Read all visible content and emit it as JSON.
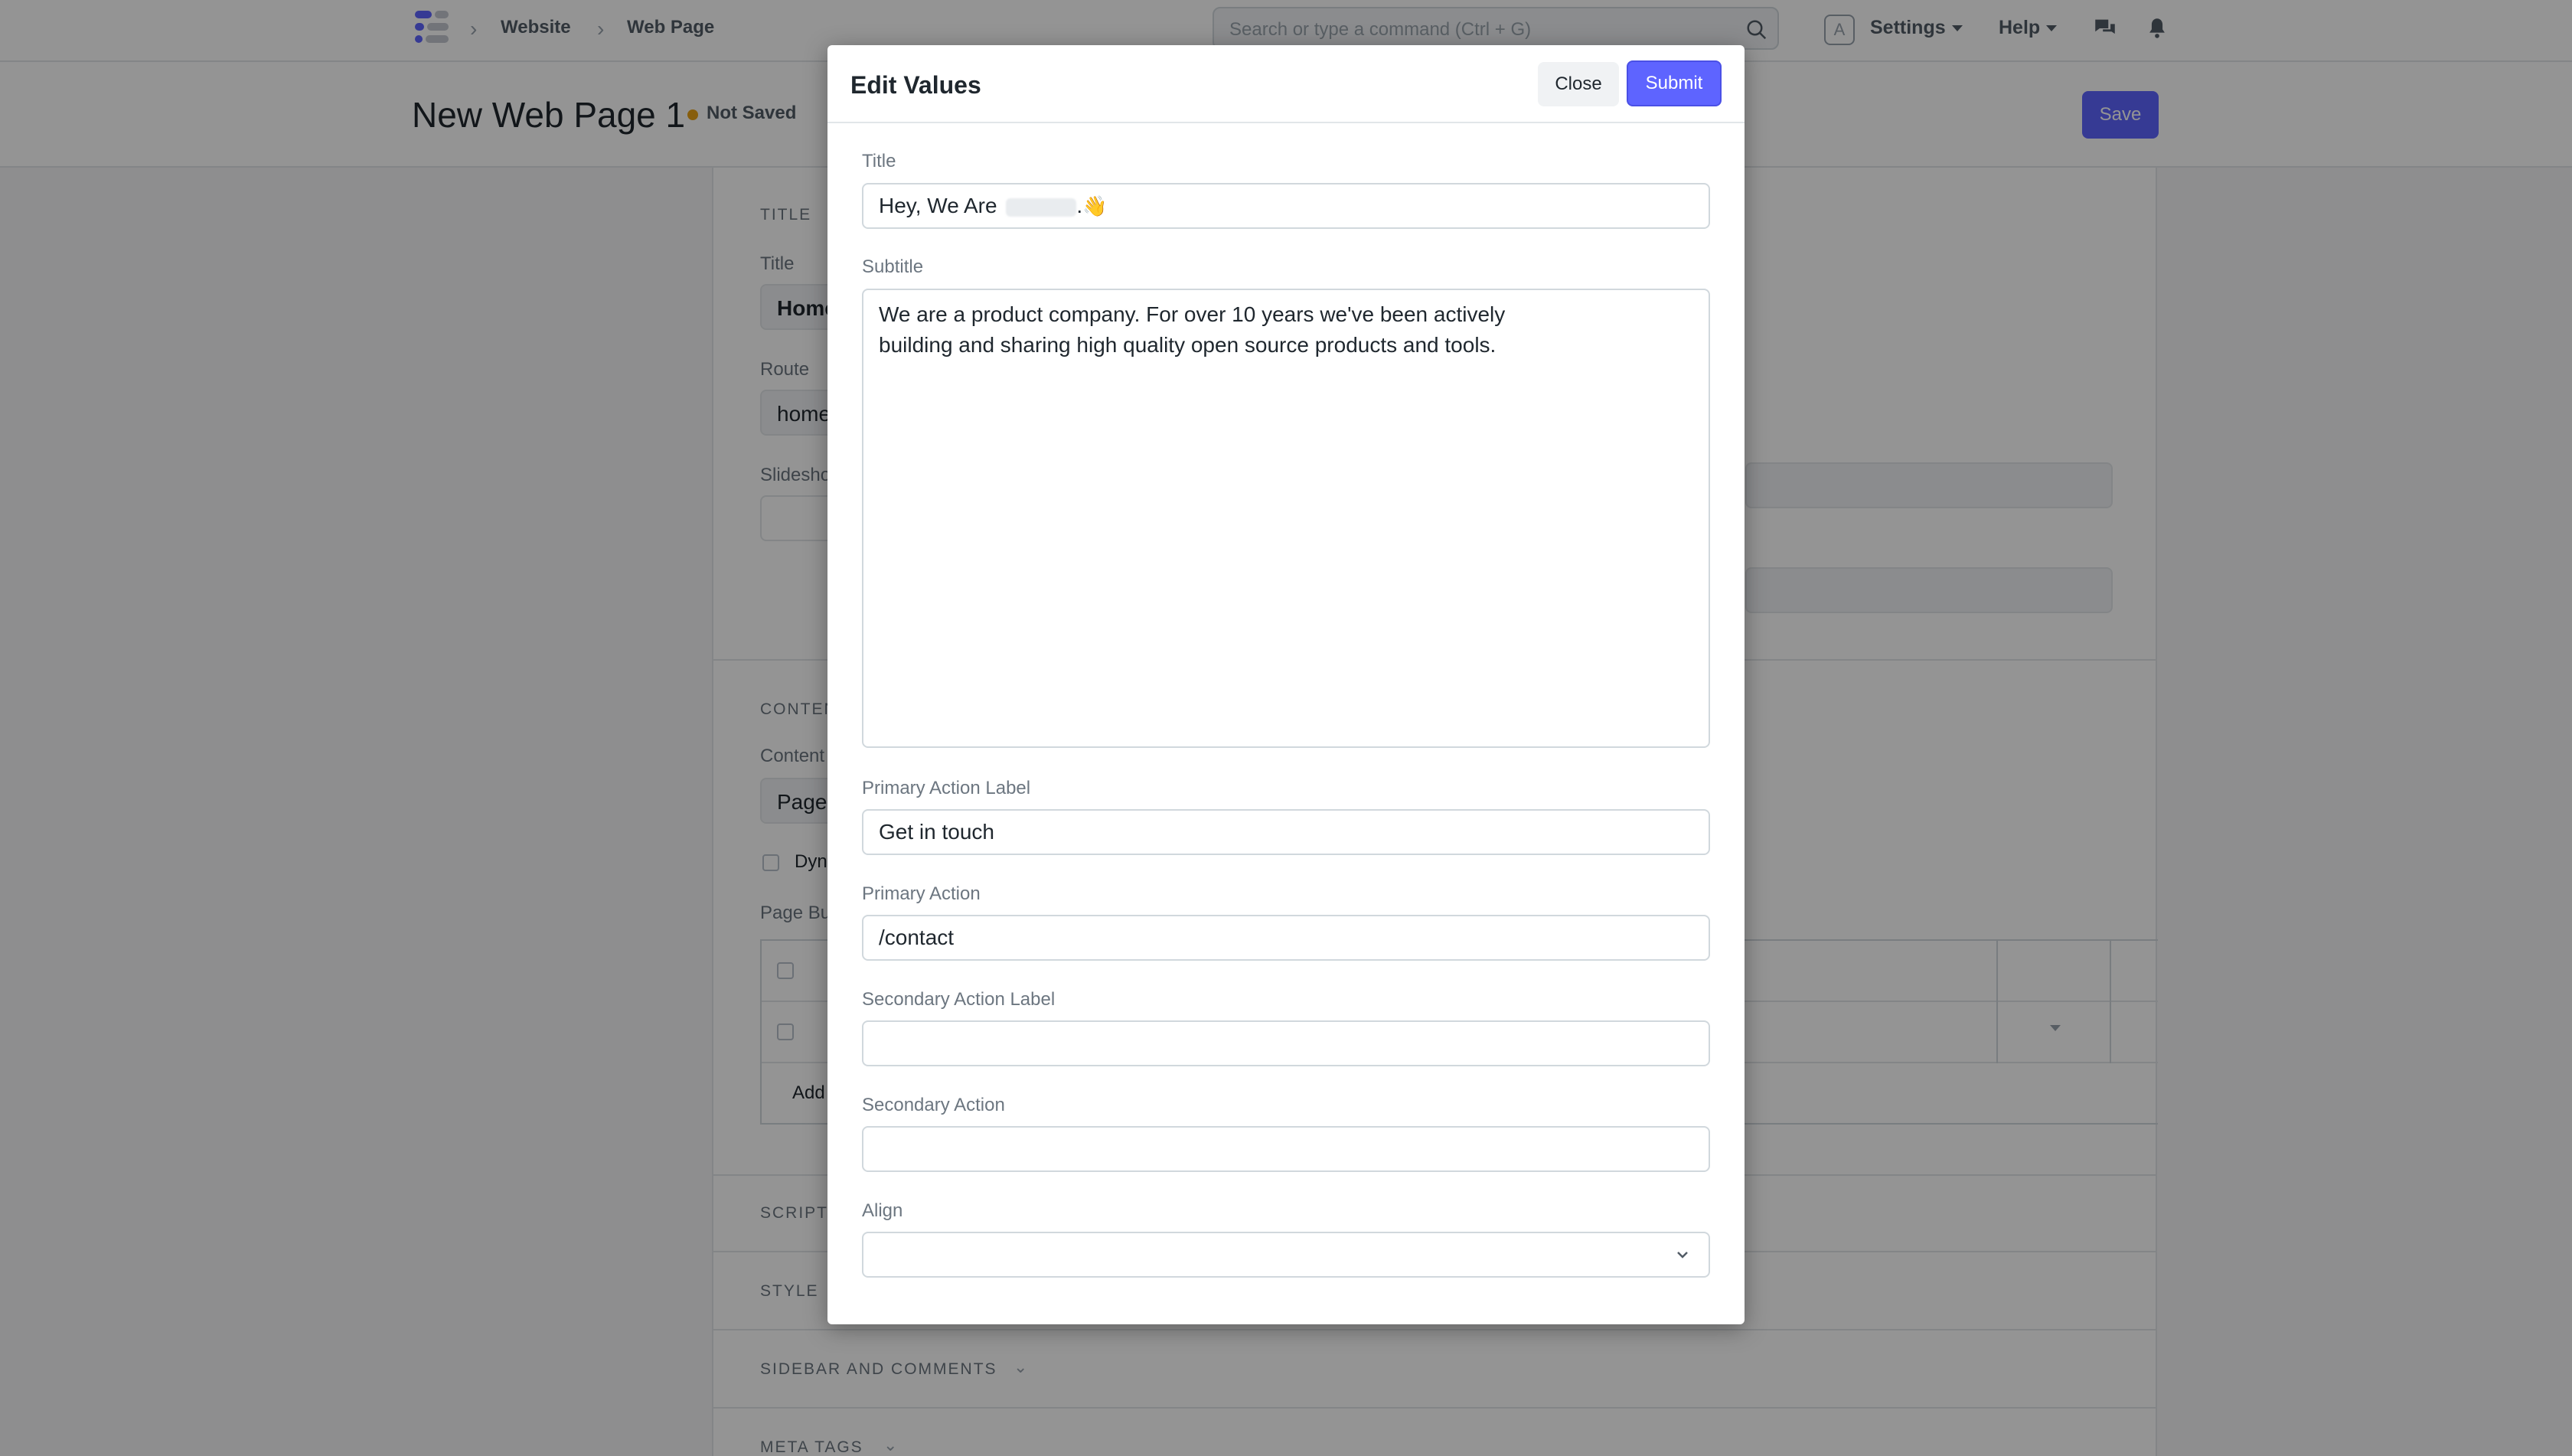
{
  "navbar": {
    "breadcrumbs": [
      "Website",
      "Web Page"
    ],
    "search_placeholder": "Search or type a command (Ctrl + G)",
    "avatar_letter": "A",
    "settings_label": "Settings",
    "help_label": "Help"
  },
  "page": {
    "title": "New Web Page 1",
    "status": "Not Saved",
    "save_label": "Save"
  },
  "background_form": {
    "section_title": "TITLE",
    "title_label": "Title",
    "title_value": "Home",
    "route_label": "Route",
    "route_value": "home",
    "slideshow_label": "Slidesho",
    "content_section": "CONTEN",
    "content_label": "Content",
    "content_value": "Page",
    "dynamic_label": "Dyn",
    "page_builder_label": "Page Bu",
    "add_row_label": "Add",
    "sections": [
      "SCRIPT",
      "STYLE",
      "SIDEBAR AND COMMENTS",
      "META TAGS"
    ]
  },
  "modal": {
    "title": "Edit Values",
    "close_label": "Close",
    "submit_label": "Submit",
    "fields": {
      "title_label": "Title",
      "title_value_prefix": "Hey, We Are",
      "title_value_suffix": ".",
      "subtitle_label": "Subtitle",
      "subtitle_line1": "We are a product company. For over 10 years we've been actively",
      "subtitle_line2": "building and sharing high quality open source products and tools.",
      "primary_action_label_label": "Primary Action Label",
      "primary_action_label_value": "Get in touch",
      "primary_action_label": "Primary Action",
      "primary_action_value": "/contact",
      "secondary_action_label_label": "Secondary Action Label",
      "secondary_action_label_value": "",
      "secondary_action_label": "Secondary Action",
      "secondary_action_value": "",
      "align_label": "Align",
      "align_value": ""
    }
  },
  "colors": {
    "accent": "#5e64ff",
    "status_dot": "#e8a317"
  },
  "icons": [
    "app-logo",
    "chevron-right-icon",
    "search-icon",
    "caret-down-icon",
    "chat-icon",
    "bell-icon",
    "chevron-down-icon",
    "waving-hand-emoji"
  ]
}
